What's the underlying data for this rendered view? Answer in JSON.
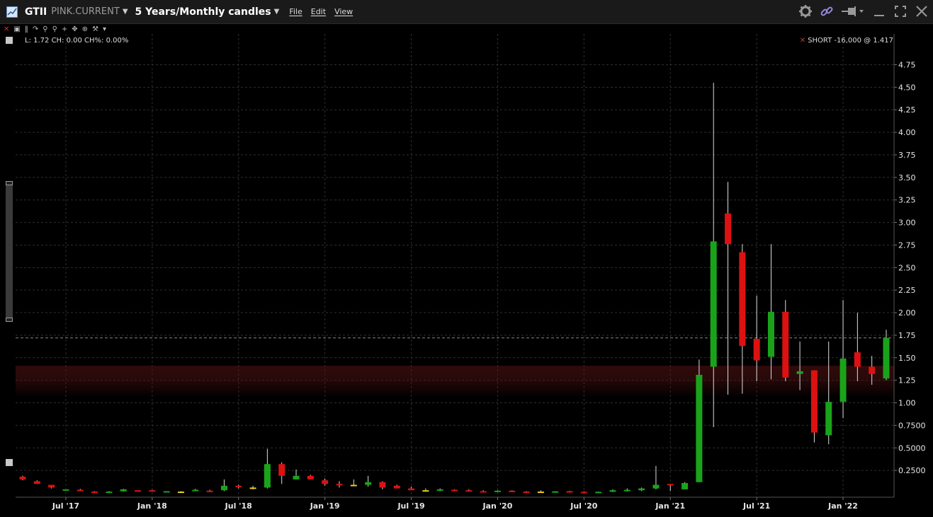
{
  "header": {
    "symbol": "GTII",
    "exchange": "PINK.CURRENT",
    "period": "5 Years/Monthly candles",
    "menus": [
      "File",
      "Edit",
      "View"
    ]
  },
  "status": {
    "ohlc_text": "L: 1.72 CH: 0.00 CH%: 0.00%",
    "position_text": "SHORT -16,000 @ 1.417"
  },
  "colors": {
    "up": "#1aa31a",
    "down": "#dd1111",
    "neutral": "#e6d31e",
    "wick": "#dddddd",
    "band": "#5a1414",
    "grid": "#2e2e2e"
  },
  "chart_data": {
    "type": "candlestick",
    "title": "",
    "xlabel": "",
    "ylabel": "",
    "ylim": [
      0,
      4.95
    ],
    "y_ticks": [
      0.25,
      0.5,
      0.75,
      1.0,
      1.25,
      1.5,
      1.75,
      2.0,
      2.25,
      2.5,
      2.75,
      3.0,
      3.25,
      3.5,
      3.75,
      4.0,
      4.25,
      4.5,
      4.75
    ],
    "y_tick_labels": [
      "0.2500",
      "0.5000",
      "0.7500",
      "1.00",
      "1.25",
      "1.50",
      "1.75",
      "2.00",
      "2.25",
      "2.50",
      "2.75",
      "3.00",
      "3.25",
      "3.50",
      "3.75",
      "4.00",
      "4.25",
      "4.50",
      "4.75"
    ],
    "x_ticks": [
      {
        "label": "Jul '17",
        "date": "2017-07"
      },
      {
        "label": "Jan '18",
        "date": "2018-01"
      },
      {
        "label": "Jul '18",
        "date": "2018-07"
      },
      {
        "label": "Jan '19",
        "date": "2019-01"
      },
      {
        "label": "Jul '19",
        "date": "2019-07"
      },
      {
        "label": "Jan '20",
        "date": "2020-01"
      },
      {
        "label": "Jul '20",
        "date": "2020-07"
      },
      {
        "label": "Jan '21",
        "date": "2021-01"
      },
      {
        "label": "Jul '21",
        "date": "2021-07"
      },
      {
        "label": "Jan '22",
        "date": "2022-01"
      }
    ],
    "last_price": 1.72,
    "position_band": [
      1.06,
      1.41
    ],
    "candles": [
      {
        "date": "2017-04",
        "open": 0.18,
        "high": 0.19,
        "low": 0.14,
        "close": 0.15
      },
      {
        "date": "2017-05",
        "open": 0.13,
        "high": 0.14,
        "low": 0.1,
        "close": 0.1
      },
      {
        "date": "2017-06",
        "open": 0.09,
        "high": 0.09,
        "low": 0.05,
        "close": 0.06
      },
      {
        "date": "2017-07",
        "open": 0.035,
        "high": 0.04,
        "low": 0.025,
        "close": 0.04
      },
      {
        "date": "2017-08",
        "open": 0.035,
        "high": 0.045,
        "low": 0.02,
        "close": 0.025
      },
      {
        "date": "2017-09",
        "open": 0.015,
        "high": 0.02,
        "low": 0.005,
        "close": 0.008
      },
      {
        "date": "2017-10",
        "open": 0.01,
        "high": 0.02,
        "low": 0.005,
        "close": 0.015
      },
      {
        "date": "2017-11",
        "open": 0.018,
        "high": 0.045,
        "low": 0.015,
        "close": 0.04
      },
      {
        "date": "2017-12",
        "open": 0.03,
        "high": 0.03,
        "low": 0.015,
        "close": 0.02
      },
      {
        "date": "2018-01",
        "open": 0.03,
        "high": 0.035,
        "low": 0.02,
        "close": 0.025
      },
      {
        "date": "2018-02",
        "open": 0.015,
        "high": 0.02,
        "low": 0.01,
        "close": 0.02
      },
      {
        "date": "2018-03",
        "open": 0.015,
        "high": 0.02,
        "low": 0.01,
        "close": 0.015
      },
      {
        "date": "2018-04",
        "open": 0.025,
        "high": 0.045,
        "low": 0.02,
        "close": 0.035
      },
      {
        "date": "2018-05",
        "open": 0.025,
        "high": 0.035,
        "low": 0.015,
        "close": 0.02
      },
      {
        "date": "2018-06",
        "open": 0.03,
        "high": 0.15,
        "low": 0.02,
        "close": 0.08
      },
      {
        "date": "2018-07",
        "open": 0.08,
        "high": 0.09,
        "low": 0.05,
        "close": 0.065
      },
      {
        "date": "2018-08",
        "open": 0.06,
        "high": 0.08,
        "low": 0.04,
        "close": 0.06
      },
      {
        "date": "2018-09",
        "open": 0.06,
        "high": 0.49,
        "low": 0.05,
        "close": 0.32
      },
      {
        "date": "2018-10",
        "open": 0.32,
        "high": 0.34,
        "low": 0.1,
        "close": 0.19
      },
      {
        "date": "2018-11",
        "open": 0.15,
        "high": 0.26,
        "low": 0.15,
        "close": 0.19
      },
      {
        "date": "2018-12",
        "open": 0.19,
        "high": 0.2,
        "low": 0.15,
        "close": 0.15
      },
      {
        "date": "2019-01",
        "open": 0.14,
        "high": 0.16,
        "low": 0.08,
        "close": 0.1
      },
      {
        "date": "2019-02",
        "open": 0.1,
        "high": 0.13,
        "low": 0.06,
        "close": 0.09
      },
      {
        "date": "2019-03",
        "open": 0.09,
        "high": 0.15,
        "low": 0.08,
        "close": 0.09
      },
      {
        "date": "2019-04",
        "open": 0.09,
        "high": 0.19,
        "low": 0.07,
        "close": 0.12
      },
      {
        "date": "2019-05",
        "open": 0.12,
        "high": 0.13,
        "low": 0.04,
        "close": 0.06
      },
      {
        "date": "2019-06",
        "open": 0.08,
        "high": 0.09,
        "low": 0.05,
        "close": 0.05
      },
      {
        "date": "2019-07",
        "open": 0.05,
        "high": 0.07,
        "low": 0.03,
        "close": 0.03
      },
      {
        "date": "2019-08",
        "open": 0.03,
        "high": 0.05,
        "low": 0.02,
        "close": 0.03
      },
      {
        "date": "2019-09",
        "open": 0.025,
        "high": 0.05,
        "low": 0.02,
        "close": 0.04
      },
      {
        "date": "2019-10",
        "open": 0.035,
        "high": 0.04,
        "low": 0.02,
        "close": 0.02
      },
      {
        "date": "2019-11",
        "open": 0.03,
        "high": 0.04,
        "low": 0.02,
        "close": 0.02
      },
      {
        "date": "2019-12",
        "open": 0.02,
        "high": 0.03,
        "low": 0.01,
        "close": 0.015
      },
      {
        "date": "2020-01",
        "open": 0.015,
        "high": 0.03,
        "low": 0.01,
        "close": 0.025
      },
      {
        "date": "2020-02",
        "open": 0.025,
        "high": 0.03,
        "low": 0.01,
        "close": 0.015
      },
      {
        "date": "2020-03",
        "open": 0.015,
        "high": 0.02,
        "low": 0.005,
        "close": 0.01
      },
      {
        "date": "2020-04",
        "open": 0.015,
        "high": 0.03,
        "low": 0.01,
        "close": 0.015
      },
      {
        "date": "2020-05",
        "open": 0.012,
        "high": 0.02,
        "low": 0.005,
        "close": 0.018
      },
      {
        "date": "2020-06",
        "open": 0.02,
        "high": 0.025,
        "low": 0.01,
        "close": 0.015
      },
      {
        "date": "2020-07",
        "open": 0.012,
        "high": 0.018,
        "low": 0.005,
        "close": 0.008
      },
      {
        "date": "2020-08",
        "open": 0.008,
        "high": 0.015,
        "low": 0.005,
        "close": 0.013
      },
      {
        "date": "2020-09",
        "open": 0.013,
        "high": 0.04,
        "low": 0.01,
        "close": 0.03
      },
      {
        "date": "2020-10",
        "open": 0.02,
        "high": 0.05,
        "low": 0.015,
        "close": 0.035
      },
      {
        "date": "2020-11",
        "open": 0.03,
        "high": 0.06,
        "low": 0.02,
        "close": 0.05
      },
      {
        "date": "2020-12",
        "open": 0.05,
        "high": 0.3,
        "low": 0.04,
        "close": 0.09
      },
      {
        "date": "2021-01",
        "open": 0.1,
        "high": 0.1,
        "low": 0.02,
        "close": 0.095
      },
      {
        "date": "2021-02",
        "open": 0.04,
        "high": 0.12,
        "low": 0.04,
        "close": 0.11
      },
      {
        "date": "2021-03",
        "open": 0.12,
        "high": 1.48,
        "low": 0.12,
        "close": 1.31
      },
      {
        "date": "2021-04",
        "open": 1.4,
        "high": 4.55,
        "low": 0.73,
        "close": 2.79
      },
      {
        "date": "2021-05",
        "open": 3.1,
        "high": 3.45,
        "low": 1.09,
        "close": 2.76
      },
      {
        "date": "2021-06",
        "open": 2.67,
        "high": 2.76,
        "low": 1.1,
        "close": 1.63
      },
      {
        "date": "2021-07",
        "open": 1.71,
        "high": 2.19,
        "low": 1.24,
        "close": 1.47
      },
      {
        "date": "2021-08",
        "open": 1.51,
        "high": 2.76,
        "low": 1.26,
        "close": 2.01
      },
      {
        "date": "2021-09",
        "open": 2.01,
        "high": 2.14,
        "low": 1.24,
        "close": 1.28
      },
      {
        "date": "2021-10",
        "open": 1.32,
        "high": 1.68,
        "low": 1.14,
        "close": 1.35
      },
      {
        "date": "2021-11",
        "open": 1.36,
        "high": 1.36,
        "low": 0.56,
        "close": 0.67
      },
      {
        "date": "2021-12",
        "open": 0.64,
        "high": 1.68,
        "low": 0.54,
        "close": 1.01
      },
      {
        "date": "2022-01",
        "open": 1.01,
        "high": 2.14,
        "low": 0.83,
        "close": 1.49
      },
      {
        "date": "2022-02",
        "open": 1.56,
        "high": 2.0,
        "low": 1.24,
        "close": 1.4
      },
      {
        "date": "2022-03",
        "open": 1.4,
        "high": 1.52,
        "low": 1.2,
        "close": 1.32
      },
      {
        "date": "2022-04",
        "open": 1.27,
        "high": 1.81,
        "low": 1.25,
        "close": 1.72
      }
    ]
  }
}
